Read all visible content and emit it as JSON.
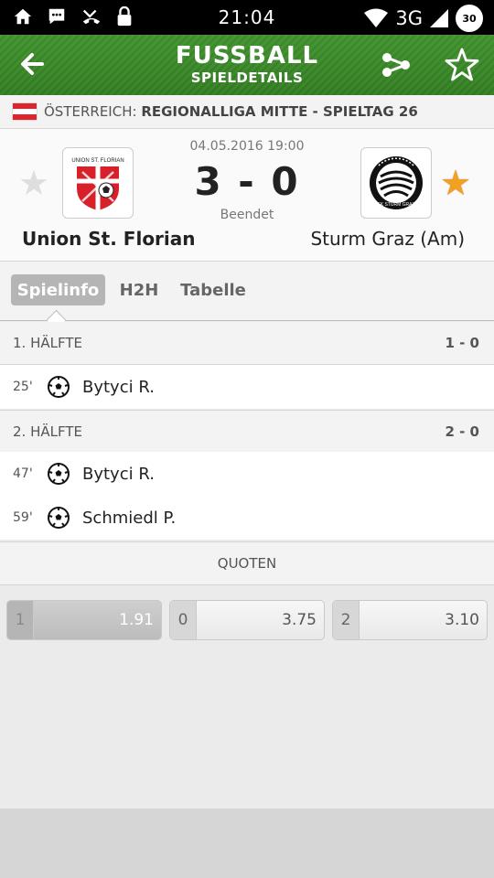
{
  "status_bar": {
    "time": "21:04",
    "network": "3G",
    "battery": "30"
  },
  "app_bar": {
    "title": "FUSSBALL",
    "subtitle": "SPIELDETAILS"
  },
  "league": {
    "country": "ÖSTERREICH:",
    "name": "REGIONALLIGA MITTE - SPIELTAG 26"
  },
  "match": {
    "date": "04.05.2016 19:00",
    "score": "3 - 0",
    "status": "Beendet",
    "home_team": "Union St. Florian",
    "away_team": "Sturm Graz (Am)",
    "home_logo_text": "UNION ST. FLORIAN",
    "away_logo_text": "SK STURM GRAZ"
  },
  "tabs": [
    {
      "label": "Spielinfo"
    },
    {
      "label": "H2H"
    },
    {
      "label": "Tabelle"
    }
  ],
  "halves": [
    {
      "label": "1. HÄLFTE",
      "score": "1 - 0",
      "events": [
        {
          "minute": "25'",
          "player": "Bytyci R."
        }
      ]
    },
    {
      "label": "2. HÄLFTE",
      "score": "2 - 0",
      "events": [
        {
          "minute": "47'",
          "player": "Bytyci R."
        },
        {
          "minute": "59'",
          "player": "Schmiedl P."
        }
      ]
    }
  ],
  "odds": {
    "header": "QUOTEN",
    "items": [
      {
        "key": "1",
        "value": "1.91"
      },
      {
        "key": "0",
        "value": "3.75"
      },
      {
        "key": "2",
        "value": "3.10"
      }
    ]
  },
  "colors": {
    "accent_green": "#2f7a1f",
    "favorite_star": "#f0a023",
    "flag_red": "#e0242c"
  }
}
